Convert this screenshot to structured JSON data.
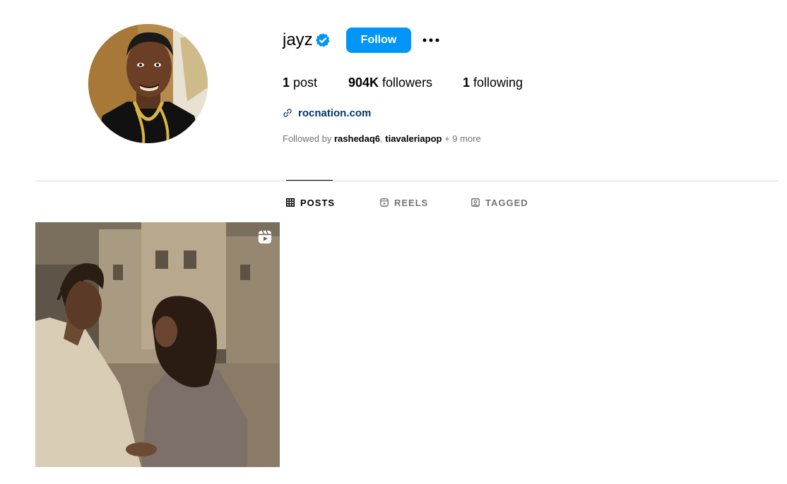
{
  "profile": {
    "username": "jayz",
    "verified": true,
    "follow_label": "Follow",
    "more_icon": "more-horizontal-icon"
  },
  "stats": {
    "posts_count": "1",
    "posts_label": " post",
    "followers_count": "904K",
    "followers_label": " followers",
    "following_count": "1",
    "following_label": " following"
  },
  "link": {
    "icon": "link-icon",
    "text": "rocnation.com"
  },
  "followed_by": {
    "prefix": "Followed by ",
    "names": [
      "rashedaq6",
      "tiavaleriapop"
    ],
    "separator": ", ",
    "more": " + 9 more"
  },
  "tabs": [
    {
      "label": "POSTS",
      "icon": "grid-icon",
      "active": true
    },
    {
      "label": "REELS",
      "icon": "reels-icon",
      "active": false
    },
    {
      "label": "TAGGED",
      "icon": "tagged-icon",
      "active": false
    }
  ],
  "posts": [
    {
      "type": "reel",
      "badge_icon": "reel-badge-icon"
    }
  ],
  "colors": {
    "follow_button": "#0095f6",
    "link": "#00376b",
    "verified": "#0095f6",
    "muted_text": "#737373",
    "divider": "#dbdbdb"
  }
}
